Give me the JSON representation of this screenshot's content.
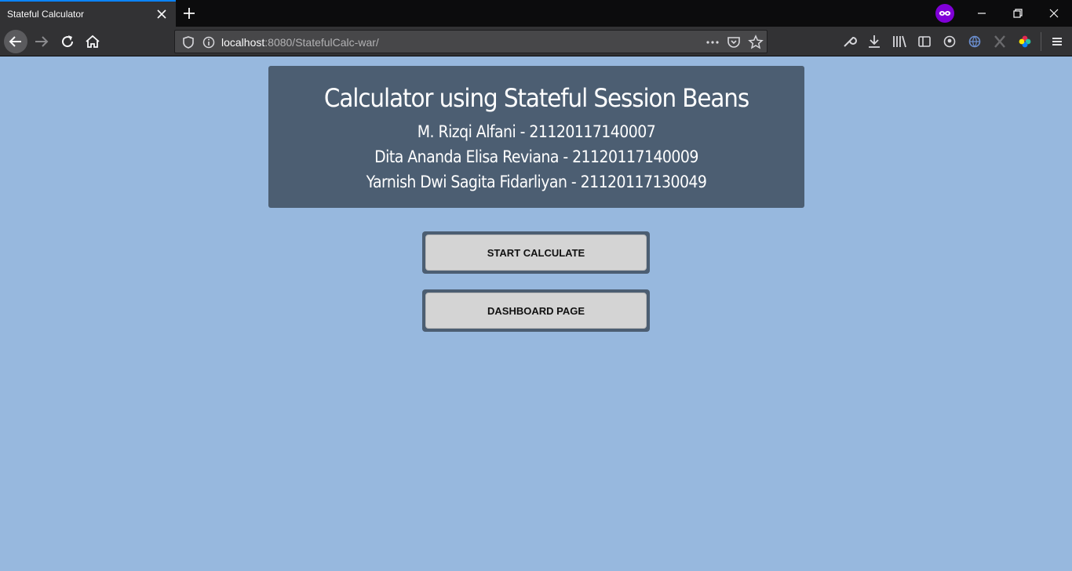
{
  "browser": {
    "tab_title": "Stateful Calculator",
    "url_host": "localhost",
    "url_rest": ":8080/StatefulCalc-war/",
    "accent_color": "#0a84ff"
  },
  "header": {
    "title": "Calculator using Stateful Session Beans",
    "members": [
      "M. Rizqi Alfani - 21120117140007",
      "Dita Ananda Elisa Reviana - 21120117140009",
      "Yarnish Dwi Sagita Fidarliyan - 21120117130049"
    ]
  },
  "buttons": {
    "start": "START CALCULATE",
    "dashboard": "DASHBOARD PAGE"
  },
  "colors": {
    "page_background": "#97b8de",
    "card_background": "#4c5e72",
    "button_face": "#d4d4d4"
  }
}
